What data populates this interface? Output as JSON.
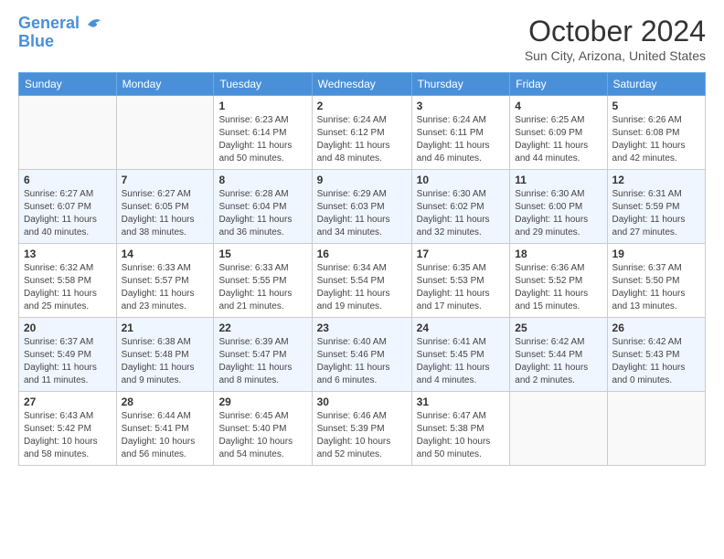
{
  "logo": {
    "line1": "General",
    "line2": "Blue"
  },
  "header": {
    "month": "October 2024",
    "location": "Sun City, Arizona, United States"
  },
  "days_of_week": [
    "Sunday",
    "Monday",
    "Tuesday",
    "Wednesday",
    "Thursday",
    "Friday",
    "Saturday"
  ],
  "weeks": [
    [
      {
        "day": "",
        "info": ""
      },
      {
        "day": "",
        "info": ""
      },
      {
        "day": "1",
        "info": "Sunrise: 6:23 AM\nSunset: 6:14 PM\nDaylight: 11 hours and 50 minutes."
      },
      {
        "day": "2",
        "info": "Sunrise: 6:24 AM\nSunset: 6:12 PM\nDaylight: 11 hours and 48 minutes."
      },
      {
        "day": "3",
        "info": "Sunrise: 6:24 AM\nSunset: 6:11 PM\nDaylight: 11 hours and 46 minutes."
      },
      {
        "day": "4",
        "info": "Sunrise: 6:25 AM\nSunset: 6:09 PM\nDaylight: 11 hours and 44 minutes."
      },
      {
        "day": "5",
        "info": "Sunrise: 6:26 AM\nSunset: 6:08 PM\nDaylight: 11 hours and 42 minutes."
      }
    ],
    [
      {
        "day": "6",
        "info": "Sunrise: 6:27 AM\nSunset: 6:07 PM\nDaylight: 11 hours and 40 minutes."
      },
      {
        "day": "7",
        "info": "Sunrise: 6:27 AM\nSunset: 6:05 PM\nDaylight: 11 hours and 38 minutes."
      },
      {
        "day": "8",
        "info": "Sunrise: 6:28 AM\nSunset: 6:04 PM\nDaylight: 11 hours and 36 minutes."
      },
      {
        "day": "9",
        "info": "Sunrise: 6:29 AM\nSunset: 6:03 PM\nDaylight: 11 hours and 34 minutes."
      },
      {
        "day": "10",
        "info": "Sunrise: 6:30 AM\nSunset: 6:02 PM\nDaylight: 11 hours and 32 minutes."
      },
      {
        "day": "11",
        "info": "Sunrise: 6:30 AM\nSunset: 6:00 PM\nDaylight: 11 hours and 29 minutes."
      },
      {
        "day": "12",
        "info": "Sunrise: 6:31 AM\nSunset: 5:59 PM\nDaylight: 11 hours and 27 minutes."
      }
    ],
    [
      {
        "day": "13",
        "info": "Sunrise: 6:32 AM\nSunset: 5:58 PM\nDaylight: 11 hours and 25 minutes."
      },
      {
        "day": "14",
        "info": "Sunrise: 6:33 AM\nSunset: 5:57 PM\nDaylight: 11 hours and 23 minutes."
      },
      {
        "day": "15",
        "info": "Sunrise: 6:33 AM\nSunset: 5:55 PM\nDaylight: 11 hours and 21 minutes."
      },
      {
        "day": "16",
        "info": "Sunrise: 6:34 AM\nSunset: 5:54 PM\nDaylight: 11 hours and 19 minutes."
      },
      {
        "day": "17",
        "info": "Sunrise: 6:35 AM\nSunset: 5:53 PM\nDaylight: 11 hours and 17 minutes."
      },
      {
        "day": "18",
        "info": "Sunrise: 6:36 AM\nSunset: 5:52 PM\nDaylight: 11 hours and 15 minutes."
      },
      {
        "day": "19",
        "info": "Sunrise: 6:37 AM\nSunset: 5:50 PM\nDaylight: 11 hours and 13 minutes."
      }
    ],
    [
      {
        "day": "20",
        "info": "Sunrise: 6:37 AM\nSunset: 5:49 PM\nDaylight: 11 hours and 11 minutes."
      },
      {
        "day": "21",
        "info": "Sunrise: 6:38 AM\nSunset: 5:48 PM\nDaylight: 11 hours and 9 minutes."
      },
      {
        "day": "22",
        "info": "Sunrise: 6:39 AM\nSunset: 5:47 PM\nDaylight: 11 hours and 8 minutes."
      },
      {
        "day": "23",
        "info": "Sunrise: 6:40 AM\nSunset: 5:46 PM\nDaylight: 11 hours and 6 minutes."
      },
      {
        "day": "24",
        "info": "Sunrise: 6:41 AM\nSunset: 5:45 PM\nDaylight: 11 hours and 4 minutes."
      },
      {
        "day": "25",
        "info": "Sunrise: 6:42 AM\nSunset: 5:44 PM\nDaylight: 11 hours and 2 minutes."
      },
      {
        "day": "26",
        "info": "Sunrise: 6:42 AM\nSunset: 5:43 PM\nDaylight: 11 hours and 0 minutes."
      }
    ],
    [
      {
        "day": "27",
        "info": "Sunrise: 6:43 AM\nSunset: 5:42 PM\nDaylight: 10 hours and 58 minutes."
      },
      {
        "day": "28",
        "info": "Sunrise: 6:44 AM\nSunset: 5:41 PM\nDaylight: 10 hours and 56 minutes."
      },
      {
        "day": "29",
        "info": "Sunrise: 6:45 AM\nSunset: 5:40 PM\nDaylight: 10 hours and 54 minutes."
      },
      {
        "day": "30",
        "info": "Sunrise: 6:46 AM\nSunset: 5:39 PM\nDaylight: 10 hours and 52 minutes."
      },
      {
        "day": "31",
        "info": "Sunrise: 6:47 AM\nSunset: 5:38 PM\nDaylight: 10 hours and 50 minutes."
      },
      {
        "day": "",
        "info": ""
      },
      {
        "day": "",
        "info": ""
      }
    ]
  ]
}
